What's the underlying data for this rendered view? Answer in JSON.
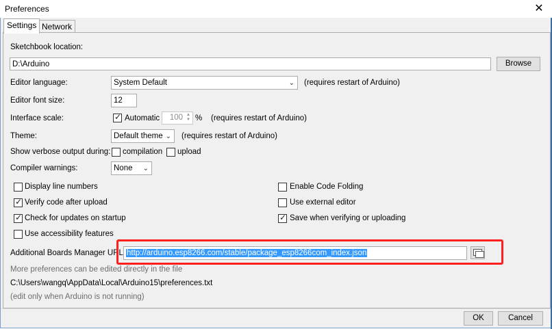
{
  "window": {
    "title": "Preferences",
    "close_glyph": "✕"
  },
  "tabs": [
    {
      "label": "Settings",
      "active": true
    },
    {
      "label": "Network",
      "active": false
    }
  ],
  "sketchbook": {
    "label": "Sketchbook location:",
    "value": "D:\\Arduino",
    "browse_label": "Browse"
  },
  "editor_language": {
    "label": "Editor language:",
    "value": "System Default",
    "note": "(requires restart of Arduino)"
  },
  "editor_font_size": {
    "label": "Editor font size:",
    "value": "12"
  },
  "interface_scale": {
    "label": "Interface scale:",
    "automatic_label": "Automatic",
    "automatic_checked": true,
    "value": "100",
    "unit": "%",
    "note": "(requires restart of Arduino)"
  },
  "theme": {
    "label": "Theme:",
    "value": "Default theme",
    "note": "(requires restart of Arduino)"
  },
  "verbose": {
    "label": "Show verbose output during:",
    "compilation_label": "compilation",
    "compilation_checked": false,
    "upload_label": "upload",
    "upload_checked": false
  },
  "compiler_warnings": {
    "label": "Compiler warnings:",
    "value": "None"
  },
  "options_left": [
    {
      "label": "Display line numbers",
      "checked": false
    },
    {
      "label": "Verify code after upload",
      "checked": true
    },
    {
      "label": "Check for updates on startup",
      "checked": true
    },
    {
      "label": "Use accessibility features",
      "checked": false
    }
  ],
  "options_right": [
    {
      "label": "Enable Code Folding",
      "checked": false
    },
    {
      "label": "Use external editor",
      "checked": false
    },
    {
      "label": "Save when verifying or uploading",
      "checked": true
    }
  ],
  "boards_manager": {
    "label": "Additional Boards Manager URLs",
    "value": "http://arduino.esp8266.com/stable/package_esp8266com_index.json"
  },
  "footer_notes": {
    "more_prefs": "More preferences can be edited directly in the file",
    "path": "C:\\Users\\wangq\\AppData\\Local\\Arduino15\\preferences.txt",
    "edit_note": "(edit only when Arduino is not running)"
  },
  "buttons": {
    "ok": "OK",
    "cancel": "Cancel"
  },
  "colors": {
    "highlight_border": "#ff1f1f",
    "selection": "#3399ff"
  }
}
